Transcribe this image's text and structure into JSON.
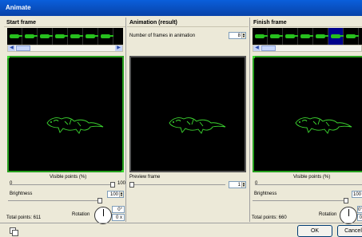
{
  "window": {
    "title": "Animate"
  },
  "start": {
    "header": "Start frame",
    "visible_label": "Visible points (%)",
    "visible_min": "0",
    "visible_max": "100",
    "brightness_label": "Brightness",
    "brightness_value": "100",
    "rotation_label": "Rotation",
    "rotation_deg": "0°",
    "rotation_x": "0 x",
    "total_points": "Total points: 611"
  },
  "animation": {
    "header": "Animation (result)",
    "frames_label": "Number of frames in animation",
    "frames_value": "8",
    "preview_label": "Preview frame",
    "preview_value": "1"
  },
  "finish": {
    "header": "Finish frame",
    "visible_label": "Visible points (%)",
    "visible_min": "0",
    "brightness_label": "Brightness",
    "brightness_value": "100",
    "rotation_label": "Rotation",
    "rotation_deg": "0°",
    "rotation_x": "0",
    "total_points": "Total points: 660"
  },
  "buttons": {
    "ok": "OK",
    "cancel": "Cancel"
  },
  "colors": {
    "title_bar": "#0a5fdb",
    "frame_border": "#27a01e",
    "lizard": "#3cd830",
    "selected_thumb": "#00008b"
  },
  "icons": {
    "thumb_left": "arrow-left-icon",
    "thumb_right": "arrow-right-icon",
    "footer": "copy-icon"
  }
}
